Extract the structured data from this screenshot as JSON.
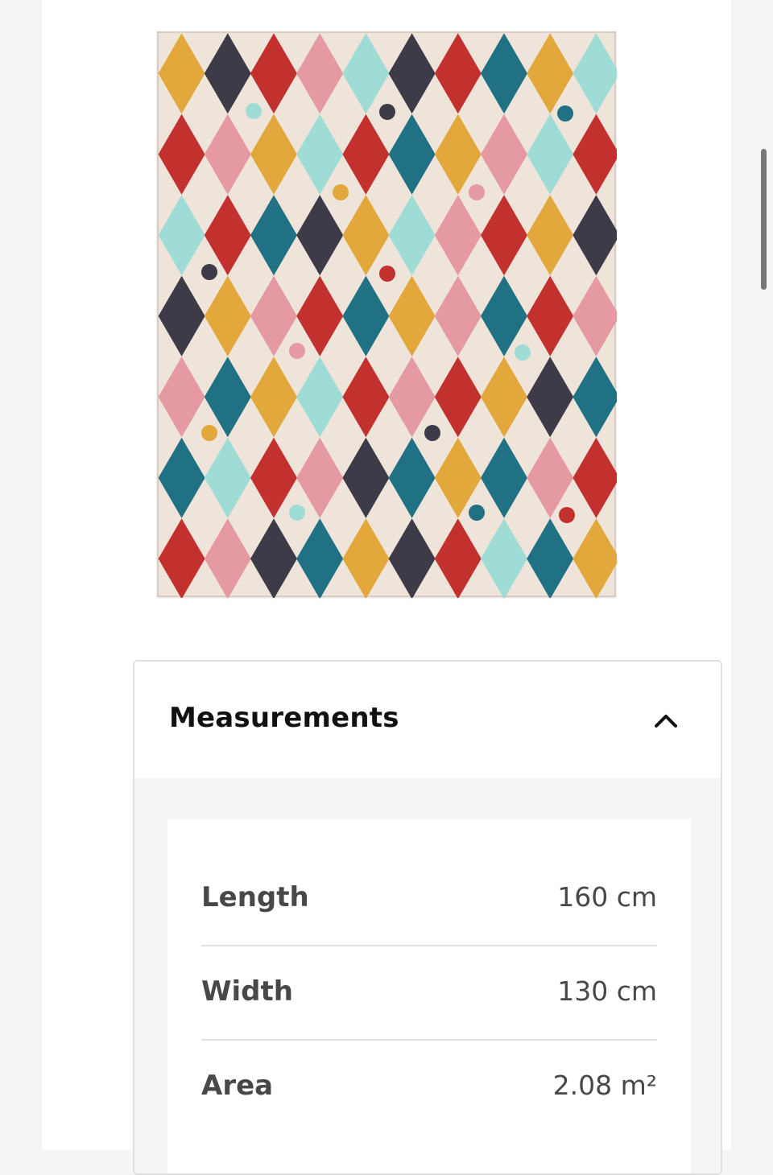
{
  "product": {
    "image_alt": "rug-product-image"
  },
  "measurements": {
    "title": "Measurements",
    "expanded": true,
    "toggle_icon": "chevron-up-icon",
    "rows": [
      {
        "label": "Length",
        "value": "160 cm"
      },
      {
        "label": "Width",
        "value": "130 cm"
      },
      {
        "label": "Area",
        "value": "2.08 m²"
      }
    ]
  }
}
